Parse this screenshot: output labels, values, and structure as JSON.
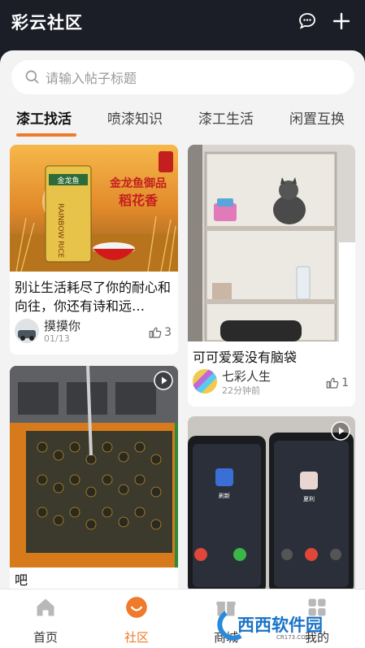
{
  "header": {
    "title": "彩云社区",
    "chat_icon": "chat-bubble-icon",
    "add_icon": "plus-icon"
  },
  "search": {
    "placeholder": "请输入帖子标题"
  },
  "tabs": [
    {
      "label": "漆工找活",
      "active": true
    },
    {
      "label": "喷漆知识",
      "active": false
    },
    {
      "label": "漆工生活",
      "active": false
    },
    {
      "label": "闲置互换",
      "active": false
    }
  ],
  "posts": [
    {
      "title": "别让生活耗尽了你的耐心和向往，你还有诗和远…",
      "author": "摸摸你",
      "time": "01/13",
      "likes": "3",
      "image_text": {
        "badge": "金龙鱼",
        "headline": "金龙鱼御品",
        "subline": "稻花香",
        "pack_text": "RAINBOW RICE"
      }
    },
    {
      "title": "可可爱爱没有脑袋",
      "author": "七彩人生",
      "time": "22分钟前",
      "likes": "1"
    },
    {
      "title": "吧",
      "video": true
    },
    {
      "video": true,
      "phone_left": "刷新",
      "phone_right": "夏利"
    }
  ],
  "bottom_nav": [
    {
      "label": "首页",
      "icon": "home-icon",
      "active": false
    },
    {
      "label": "社区",
      "icon": "community-smile-icon",
      "active": true
    },
    {
      "label": "商城",
      "icon": "gift-icon",
      "active": false
    },
    {
      "label": "我的",
      "icon": "profile-icon",
      "active": false
    }
  ],
  "watermark": {
    "text": "西西软件园",
    "sub": "CR173.COM"
  },
  "colors": {
    "accent": "#f07a2c",
    "header_bg": "#1b1e27",
    "panel_bg": "#f3f3f3"
  }
}
